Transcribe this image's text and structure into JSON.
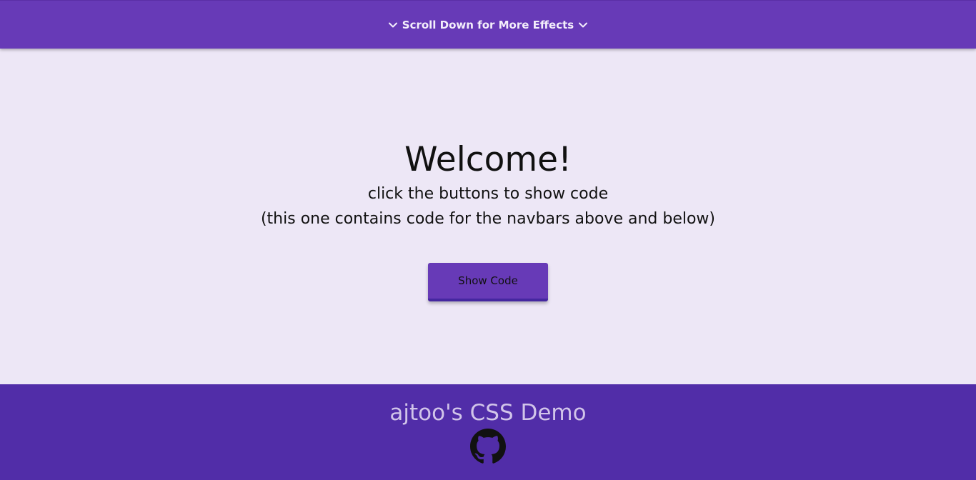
{
  "topbar": {
    "label": "Scroll Down for More Effects",
    "left_icon": "chevron-down-icon",
    "right_icon": "chevron-down-icon"
  },
  "main": {
    "heading": "Welcome!",
    "line1": "click the buttons to show code",
    "line2": "(this one contains code for the navbars above and below)",
    "button_label": "Show Code"
  },
  "footer": {
    "title": "ajtoo's CSS Demo",
    "icon": "github-icon"
  },
  "colors": {
    "navbar": "#673ab7",
    "background": "#ede7f6",
    "footer": "#512da8",
    "footer_text": "#d1c4e9"
  }
}
